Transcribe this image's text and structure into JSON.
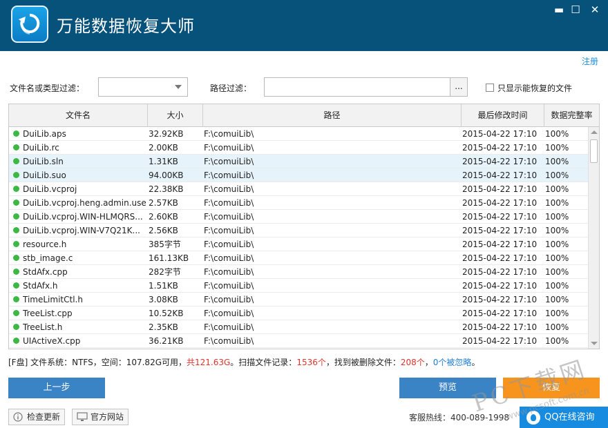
{
  "app": {
    "title": "万能数据恢复大师",
    "register_label": "注册"
  },
  "window_controls": {
    "minimize": "▬",
    "maximize": "☐",
    "close": "✕"
  },
  "filters": {
    "name_type_label": "文件名或类型过滤：",
    "name_type_value": "",
    "path_label": "路径过滤：",
    "path_value": "",
    "browse_label": "...",
    "only_recoverable_label": "只显示能恢复的文件",
    "only_recoverable_checked": false
  },
  "table": {
    "columns": [
      "文件名",
      "大小",
      "路径",
      "最后修改时间",
      "数据完整率"
    ],
    "rows": [
      {
        "name": "DuiLib.aps",
        "size": "32.92KB",
        "path": "F:\\comuiLib\\",
        "time": "2015-04-22   17:10",
        "rate": "100%",
        "selected": false
      },
      {
        "name": "DuiLib.rc",
        "size": "2.00KB",
        "path": "F:\\comuiLib\\",
        "time": "2015-04-22   17:10",
        "rate": "100%",
        "selected": false
      },
      {
        "name": "DuiLib.sln",
        "size": "1.31KB",
        "path": "F:\\comuiLib\\",
        "time": "2015-04-22   17:10",
        "rate": "100%",
        "selected": true
      },
      {
        "name": "DuiLib.suo",
        "size": "94.00KB",
        "path": "F:\\comuiLib\\",
        "time": "2015-04-22   17:10",
        "rate": "100%",
        "selected": true
      },
      {
        "name": "DuiLib.vcproj",
        "size": "22.38KB",
        "path": "F:\\comuiLib\\",
        "time": "2015-04-22   17:10",
        "rate": "100%",
        "selected": false
      },
      {
        "name": "DuiLib.vcproj.heng.admin.user",
        "size": "2.57KB",
        "path": "F:\\comuiLib\\",
        "time": "2015-04-22   17:10",
        "rate": "100%",
        "selected": false
      },
      {
        "name": "DuiLib.vcproj.WIN-HLMQRS...",
        "size": "2.60KB",
        "path": "F:\\comuiLib\\",
        "time": "2015-04-22   17:10",
        "rate": "100%",
        "selected": false
      },
      {
        "name": "DuiLib.vcproj.WIN-V7Q21K...",
        "size": "2.56KB",
        "path": "F:\\comuiLib\\",
        "time": "2015-04-22   17:10",
        "rate": "100%",
        "selected": false
      },
      {
        "name": "resource.h",
        "size": "385字节",
        "path": "F:\\comuiLib\\",
        "time": "2015-04-22   17:10",
        "rate": "100%",
        "selected": false
      },
      {
        "name": "stb_image.c",
        "size": "161.13KB",
        "path": "F:\\comuiLib\\",
        "time": "2015-04-22   17:10",
        "rate": "100%",
        "selected": false
      },
      {
        "name": "StdAfx.cpp",
        "size": "282字节",
        "path": "F:\\comuiLib\\",
        "time": "2015-04-22   17:10",
        "rate": "100%",
        "selected": false
      },
      {
        "name": "StdAfx.h",
        "size": "1.51KB",
        "path": "F:\\comuiLib\\",
        "time": "2015-04-22   17:10",
        "rate": "100%",
        "selected": false
      },
      {
        "name": "TimeLimitCtl.h",
        "size": "3.08KB",
        "path": "F:\\comuiLib\\",
        "time": "2015-04-22   17:10",
        "rate": "100%",
        "selected": false
      },
      {
        "name": "TreeList.cpp",
        "size": "10.52KB",
        "path": "F:\\comuiLib\\",
        "time": "2015-04-22   17:10",
        "rate": "100%",
        "selected": false
      },
      {
        "name": "TreeList.h",
        "size": "2.35KB",
        "path": "F:\\comuiLib\\",
        "time": "2015-04-22   17:10",
        "rate": "100%",
        "selected": false
      },
      {
        "name": "UIActiveX.cpp",
        "size": "36.21KB",
        "path": "F:\\comuiLib\\",
        "time": "2015-04-22   17:10",
        "rate": "100%",
        "selected": false
      }
    ]
  },
  "status": {
    "drive": "[F盘]",
    "fs_text": " 文件系统：NTFS，空间：107.82G可用，",
    "total": "共121.63G",
    "scan_label": "。扫描文件记录：",
    "scan_count": "1536个",
    "found_label": "，找到被删除文件：",
    "found_count": "208个",
    "sep": "，",
    "ignored": "0个被忽略",
    "end": "。"
  },
  "buttons": {
    "back": "上一步",
    "preview": "预览",
    "recover": "恢复"
  },
  "footer": {
    "check_update": "检查更新",
    "official_site": "官方网站",
    "hotline": "客服热线：400-089-1998",
    "qq_support": "QQ在线咨询"
  },
  "watermark": {
    "main": "PC下载网",
    "sub": "www.pcsoft.com.cn"
  },
  "colors": {
    "header": "#07527b",
    "primary_button": "#3a83c4",
    "recover_button": "#f6941d",
    "status_dot": "#3db845",
    "highlight_red": "#e0332a",
    "link_blue": "#1d7fd6"
  }
}
